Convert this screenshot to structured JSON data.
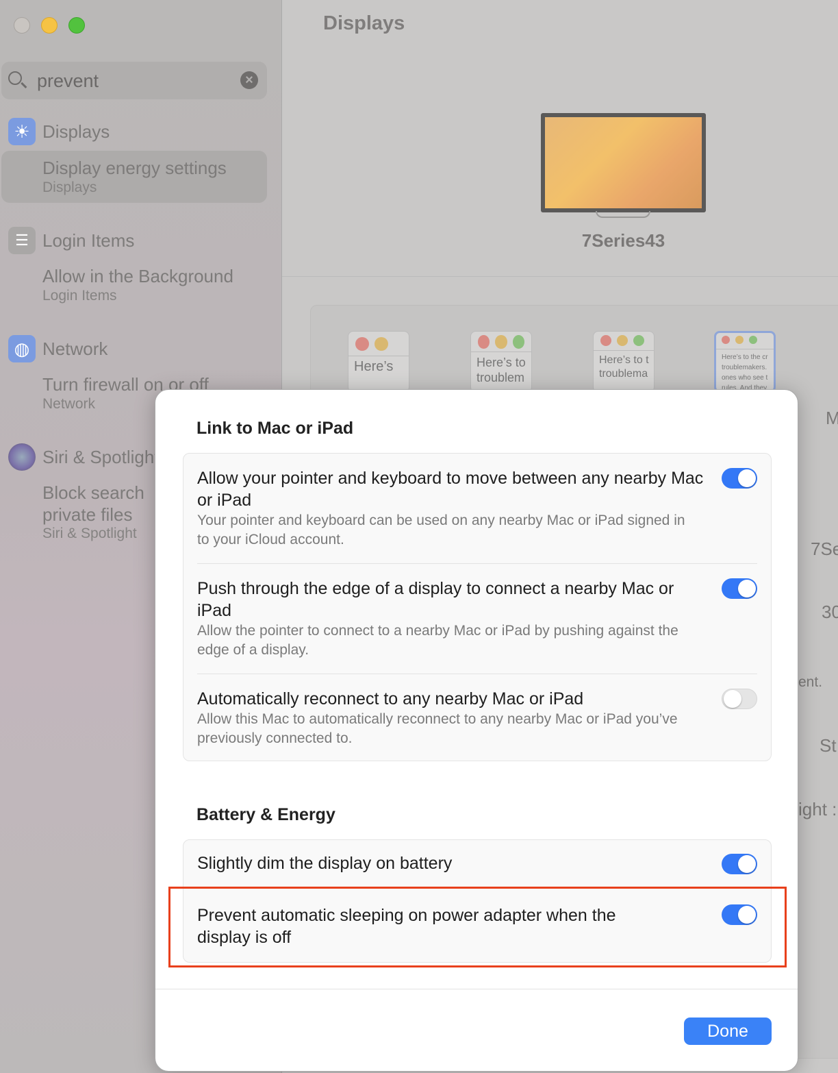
{
  "window": {
    "traffic_lights": {
      "close": "#c9c5c1",
      "minimize": "#f6c344",
      "zoom": "#52c23e"
    }
  },
  "search": {
    "value": "prevent",
    "clear_icon": "x-circle-icon"
  },
  "sidebar": {
    "groups": [
      {
        "title": "Displays",
        "icon": "sun-icon",
        "color": "#7b9be0",
        "results": [
          {
            "label": "Display energy settings",
            "sub": "Displays",
            "selected": true
          }
        ]
      },
      {
        "title": "Login Items",
        "icon": "list-icon",
        "color": "#a9a7a6",
        "results": [
          {
            "label": "Allow in the Background",
            "sub": "Login Items"
          }
        ]
      },
      {
        "title": "Network",
        "icon": "globe-icon",
        "color": "#7b9be0",
        "results": [
          {
            "label": "Turn firewall on or off",
            "sub": "Network"
          }
        ]
      },
      {
        "title": "Siri & Spotlight",
        "icon": "siri-icon",
        "color": "#8a7fb8",
        "results": [
          {
            "label": "Block search private files",
            "label_line1": "Block search",
            "label_line2": "private files",
            "sub": "Siri & Spotlight"
          }
        ]
      }
    ]
  },
  "main": {
    "title": "Displays",
    "monitor_name": "7Series43",
    "thumbnails": [
      "Here’s",
      "Here’s to troublem",
      "Here’s to t troublema",
      "Here’s to the cr troublemakers. ones who see t rules. And they"
    ],
    "right_fragments": [
      "M",
      "7Se",
      "30",
      "ent.",
      "St",
      "ight :"
    ]
  },
  "dialog": {
    "section1": {
      "title": "Link to Mac or iPad",
      "rows": [
        {
          "label": "Allow your pointer and keyboard to move between any nearby Mac or iPad",
          "desc": "Your pointer and keyboard can be used on any nearby Mac or iPad signed in to your iCloud account.",
          "on": true
        },
        {
          "label": "Push through the edge of a display to connect a nearby Mac or iPad",
          "desc": "Allow the pointer to connect to a nearby Mac or iPad by pushing against the edge of a display.",
          "on": true
        },
        {
          "label": "Automatically reconnect to any nearby Mac or iPad",
          "desc": "Allow this Mac to automatically reconnect to any nearby Mac or iPad you’ve previously connected to.",
          "on": false
        }
      ]
    },
    "section2": {
      "title": "Battery & Energy",
      "rows": [
        {
          "label": "Slightly dim the display on battery",
          "on": true
        },
        {
          "label": "Prevent automatic sleeping on power adapter when the display is off",
          "on": true,
          "highlighted": true
        }
      ]
    },
    "done_label": "Done",
    "highlight_color": "#e8401c"
  }
}
